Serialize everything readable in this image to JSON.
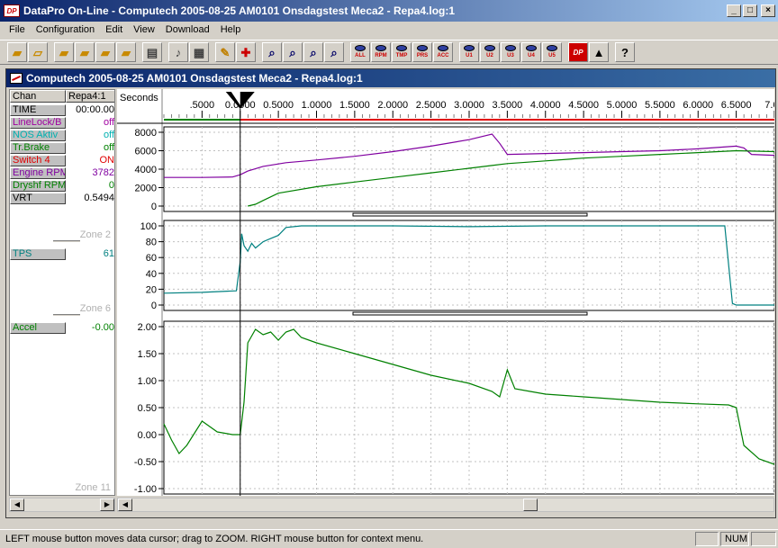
{
  "window": {
    "logo": "DP",
    "title": "DataPro On-Line - Computech 2005-08-25 AM0101 Onsdagstest Meca2 - Repa4.log:1",
    "minimize": "_",
    "maximize": "□",
    "close": "×"
  },
  "menu": [
    {
      "label": "File"
    },
    {
      "label": "Configuration"
    },
    {
      "label": "Edit"
    },
    {
      "label": "View"
    },
    {
      "label": "Download"
    },
    {
      "label": "Help"
    }
  ],
  "toolbar": {
    "eye_buttons": [
      "ALL",
      "RPM",
      "TMP",
      "PRS",
      "ACC",
      "U1",
      "U2",
      "U3",
      "U4",
      "U5"
    ],
    "dp_label": "DP"
  },
  "child": {
    "title": "Computech 2005-08-25 AM0101 Onsdagstest Meca2 - Repa4.log:1"
  },
  "channels": {
    "header_chan": "Chan",
    "header_file": "Repa4:1",
    "zone1": [
      {
        "name": "TIME",
        "value": "00:00.00",
        "color": "#000000"
      },
      {
        "name": "LineLock/B",
        "value": "off",
        "color": "#a000a0"
      },
      {
        "name": "NOS Aktiv",
        "value": "off",
        "color": "#00b0b0"
      },
      {
        "name": "Tr.Brake",
        "value": "off",
        "color": "#008000"
      },
      {
        "name": "Switch 4",
        "value": "ON",
        "color": "#e00000"
      },
      {
        "name": "Engine RPM",
        "value": "3782",
        "color": "#8000a0"
      },
      {
        "name": "Dryshf RPM",
        "value": "0",
        "color": "#008000"
      },
      {
        "name": "VRT",
        "value": "0.5494",
        "color": "#000000"
      }
    ],
    "zone2_label": "Zone 2",
    "zone2": [
      {
        "name": "TPS",
        "value": "61",
        "color": "#008080"
      }
    ],
    "zone6_label": "Zone 6",
    "zone3": [
      {
        "name": "Accel",
        "value": "-0.00",
        "color": "#008000"
      }
    ],
    "zone11_label": "Zone 11"
  },
  "chart_data": [
    {
      "type": "line",
      "xlabel": "Seconds",
      "x_ticks": [
        ".5000",
        "0.0000",
        "0.5000",
        "1.0000",
        "1.5000",
        "2.0000",
        "2.5000",
        "3.0000",
        "3.5000",
        "4.0000",
        "4.5000",
        "5.0000",
        "5.5000",
        "6.0000",
        "6.5000",
        "7.00"
      ],
      "ylim": [
        0,
        8000
      ],
      "y_ticks": [
        "8000",
        "6000",
        "4000",
        "2000",
        "0"
      ],
      "series": [
        {
          "name": "Engine RPM",
          "color": "#8000a0",
          "x": [
            -1.0,
            -0.5,
            -0.1,
            0.0,
            0.1,
            0.3,
            0.6,
            1.0,
            1.5,
            2.0,
            2.5,
            3.0,
            3.3,
            3.4,
            3.5,
            4.0,
            4.5,
            5.0,
            5.5,
            6.0,
            6.5,
            6.6,
            6.7,
            7.0
          ],
          "y": [
            3100,
            3100,
            3150,
            3400,
            3800,
            4300,
            4700,
            5000,
            5400,
            5900,
            6500,
            7200,
            7800,
            6800,
            5600,
            5700,
            5800,
            5900,
            6000,
            6200,
            6500,
            6300,
            5600,
            5500
          ]
        },
        {
          "name": "Dryshf RPM",
          "color": "#008000",
          "x": [
            0.1,
            0.2,
            0.3,
            0.5,
            1.0,
            1.5,
            2.0,
            2.5,
            3.0,
            3.3,
            3.5,
            4.0,
            4.5,
            5.0,
            5.5,
            6.0,
            6.5,
            7.0
          ],
          "y": [
            0,
            200,
            600,
            1400,
            2100,
            2600,
            3100,
            3600,
            4100,
            4400,
            4600,
            4900,
            5200,
            5400,
            5600,
            5800,
            6000,
            5900
          ]
        }
      ]
    },
    {
      "type": "line",
      "ylim": [
        0,
        100
      ],
      "y_ticks": [
        "100",
        "80",
        "60",
        "40",
        "20",
        "0"
      ],
      "series": [
        {
          "name": "TPS",
          "color": "#008080",
          "x": [
            -1.0,
            -0.5,
            -0.05,
            0.0,
            0.02,
            0.05,
            0.1,
            0.15,
            0.2,
            0.3,
            0.4,
            0.5,
            0.6,
            0.8,
            1.0,
            2.0,
            3.0,
            4.0,
            5.0,
            6.0,
            6.35,
            6.45,
            6.5,
            7.0
          ],
          "y": [
            15,
            16,
            18,
            55,
            90,
            75,
            68,
            78,
            72,
            80,
            84,
            88,
            98,
            100,
            100,
            100,
            99,
            100,
            100,
            100,
            100,
            2,
            0,
            0
          ]
        }
      ]
    },
    {
      "type": "line",
      "ylim": [
        -1.0,
        2.0
      ],
      "y_ticks": [
        "2.00",
        "1.50",
        "1.00",
        "0.50",
        "0.00",
        "-0.50",
        "-1.00"
      ],
      "series": [
        {
          "name": "Accel",
          "color": "#008000",
          "x": [
            -1.0,
            -0.9,
            -0.8,
            -0.7,
            -0.5,
            -0.3,
            -0.1,
            0.0,
            0.05,
            0.1,
            0.2,
            0.3,
            0.4,
            0.5,
            0.6,
            0.7,
            0.8,
            1.0,
            1.5,
            2.0,
            2.5,
            3.0,
            3.3,
            3.4,
            3.5,
            3.6,
            3.8,
            4.0,
            4.5,
            5.0,
            5.5,
            6.0,
            6.4,
            6.5,
            6.6,
            6.8,
            7.0
          ],
          "y": [
            0.2,
            -0.1,
            -0.35,
            -0.2,
            0.25,
            0.05,
            0.0,
            0.0,
            0.6,
            1.7,
            1.95,
            1.85,
            1.9,
            1.75,
            1.9,
            1.95,
            1.8,
            1.7,
            1.5,
            1.3,
            1.1,
            0.95,
            0.8,
            0.7,
            1.2,
            0.85,
            0.8,
            0.75,
            0.7,
            0.65,
            0.6,
            0.57,
            0.55,
            0.5,
            -0.2,
            -0.45,
            -0.55
          ]
        }
      ]
    }
  ],
  "status": {
    "text": "LEFT mouse button moves data cursor;  drag to ZOOM.  RIGHT mouse button for context menu.",
    "num": "NUM"
  }
}
